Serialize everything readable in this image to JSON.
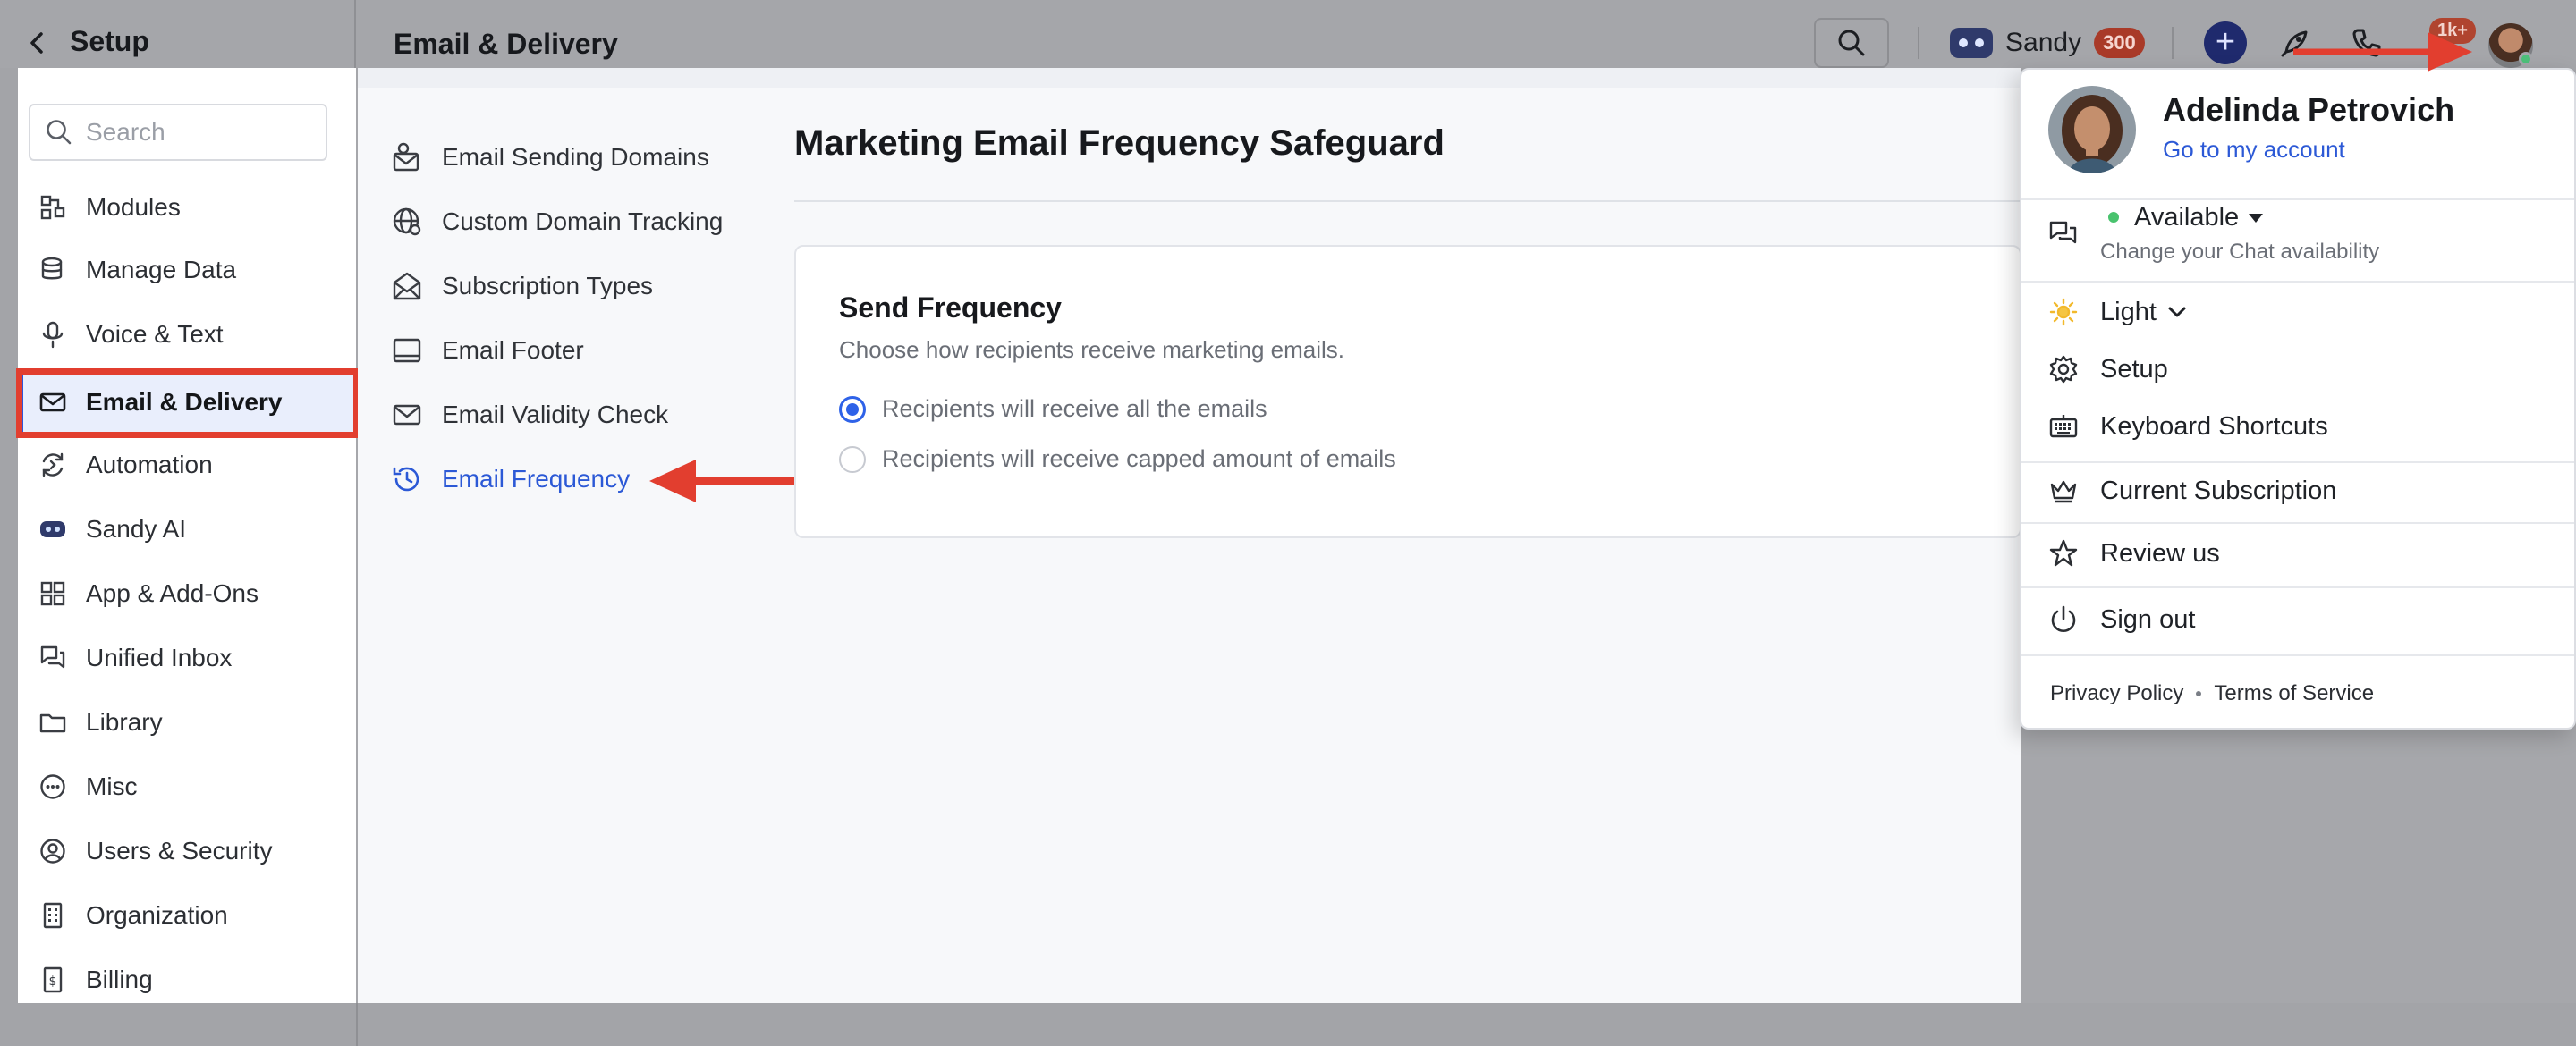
{
  "header": {
    "back_label": "Setup",
    "section_title": "Email & Delivery",
    "agent_name": "Sandy",
    "agent_count": "300",
    "notifications_count": "1k+"
  },
  "sidebar": {
    "search_placeholder": "Search",
    "items": [
      {
        "label": "Modules",
        "icon": "modules-icon"
      },
      {
        "label": "Manage Data",
        "icon": "database-icon"
      },
      {
        "label": "Voice & Text",
        "icon": "microphone-icon"
      },
      {
        "label": "Email & Delivery",
        "icon": "envelope-icon",
        "active": true
      },
      {
        "label": "Automation",
        "icon": "automation-icon"
      },
      {
        "label": "Sandy AI",
        "icon": "sandy-ai-icon"
      },
      {
        "label": "App & Add-Ons",
        "icon": "apps-grid-icon"
      },
      {
        "label": "Unified Inbox",
        "icon": "chat-bubbles-icon"
      },
      {
        "label": "Library",
        "icon": "folder-icon"
      },
      {
        "label": "Misc",
        "icon": "dots-circle-icon"
      },
      {
        "label": "Users & Security",
        "icon": "user-circle-icon"
      },
      {
        "label": "Organization",
        "icon": "building-icon"
      },
      {
        "label": "Billing",
        "icon": "billing-icon"
      }
    ]
  },
  "subnav": {
    "items": [
      {
        "label": "Email Sending Domains",
        "icon": "sending-domain-icon"
      },
      {
        "label": "Custom Domain Tracking",
        "icon": "globe-icon"
      },
      {
        "label": "Subscription Types",
        "icon": "subscription-mail-icon"
      },
      {
        "label": "Email Footer",
        "icon": "footer-icon"
      },
      {
        "label": "Email Validity Check",
        "icon": "mail-check-icon"
      },
      {
        "label": "Email Frequency",
        "icon": "history-icon",
        "active": true
      }
    ]
  },
  "main": {
    "page_title": "Marketing Email Frequency Safeguard",
    "card_title": "Send Frequency",
    "card_description": "Choose how recipients receive marketing emails.",
    "options": [
      {
        "label": "Recipients will receive all the emails",
        "selected": true
      },
      {
        "label": "Recipients will receive capped amount of emails",
        "selected": false
      }
    ]
  },
  "dropdown": {
    "user_name": "Adelinda Petrovich",
    "account_link": "Go to my account",
    "availability": "Available",
    "availability_hint": "Change your Chat availability",
    "theme": "Light",
    "setup": "Setup",
    "shortcuts": "Keyboard Shortcuts",
    "subscription": "Current Subscription",
    "review": "Review us",
    "sign_out": "Sign out",
    "privacy": "Privacy Policy",
    "terms": "Terms of Service"
  },
  "colors": {
    "accent": "#2c59d6",
    "annotation_red": "#e23e2f",
    "available_green": "#49c36e"
  }
}
